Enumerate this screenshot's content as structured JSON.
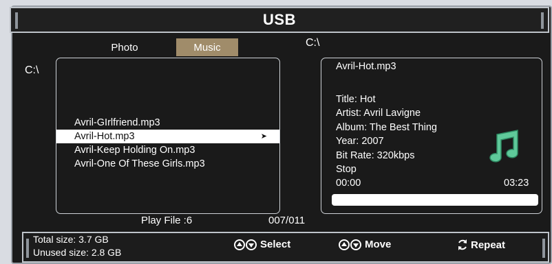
{
  "header": {
    "title": "USB"
  },
  "tabs": [
    {
      "label": "Photo",
      "selected": false
    },
    {
      "label": "Music",
      "selected": true
    }
  ],
  "paths": {
    "left": "C:\\",
    "right": "C:\\"
  },
  "file_list": {
    "items": [
      {
        "name": "Avril-GIrlfriend.mp3",
        "selected": false
      },
      {
        "name": "Avril-Hot.mp3",
        "selected": true
      },
      {
        "name": "Avril-Keep Holding On.mp3",
        "selected": false
      },
      {
        "name": "Avril-One Of These Girls.mp3",
        "selected": false
      }
    ]
  },
  "info": {
    "filename": "Avril-Hot.mp3",
    "title": "Title: Hot",
    "artist": "Artist: Avril Lavigne",
    "album": "Album: The Best Thing",
    "year": "Year: 2007",
    "bitrate": "Bit Rate: 320kbps",
    "state": "Stop",
    "elapsed": "00:00",
    "total": "03:23",
    "progress": 0,
    "icon": "music-note-icon",
    "icon_color": "#5fc99a"
  },
  "footer": {
    "play_file": "Play File :6",
    "page": "007/011"
  },
  "status": {
    "total_size": "Total size: 3.7 GB",
    "unused_size": "Unused size: 2.8 GB",
    "hints": [
      {
        "icon": "up-down-icon",
        "label": "Select"
      },
      {
        "icon": "up-down-icon",
        "label": "Move"
      },
      {
        "icon": "repeat-icon",
        "label": "Repeat"
      }
    ]
  },
  "colors": {
    "tab_selected": "#a08c6a",
    "background": "#1a1a1a"
  }
}
